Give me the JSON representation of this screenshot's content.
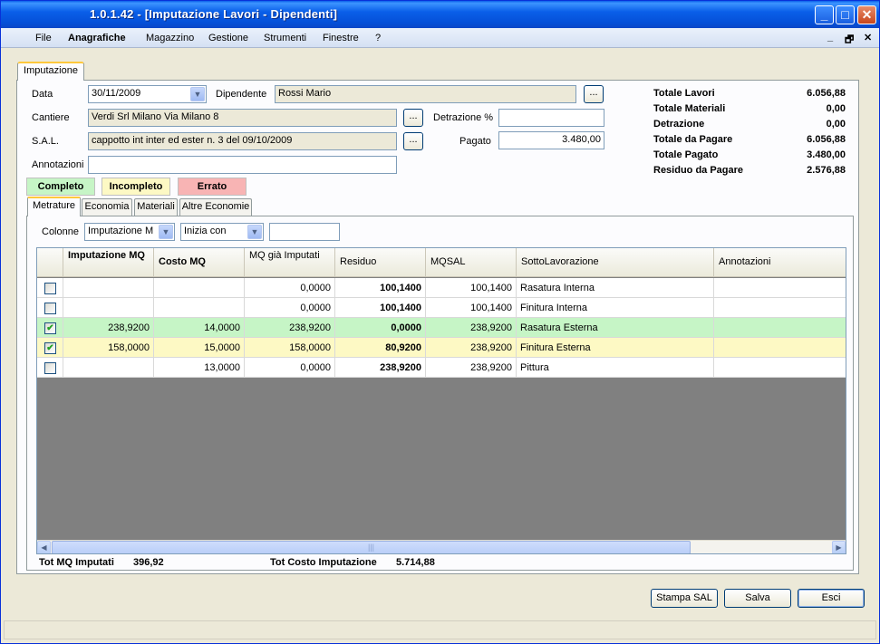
{
  "window": {
    "title": "1.0.1.42 - [Imputazione Lavori - Dipendenti]",
    "controls": {
      "minimize": "_",
      "maximize": "□",
      "close": "✕"
    }
  },
  "menu": {
    "items": [
      "File",
      "Anagrafiche",
      "Magazzino",
      "Gestione",
      "Strumenti",
      "Finestre",
      "?"
    ],
    "mdi_controls": [
      "_",
      "🗗",
      "✕"
    ]
  },
  "main_tab": "Imputazione",
  "form": {
    "data_label": "Data",
    "data_value": "30/11/2009",
    "dipendente_label": "Dipendente",
    "dipendente_value": "Rossi Mario",
    "cantiere_label": "Cantiere",
    "cantiere_value": "Verdi Srl Milano Via Milano 8",
    "sal_label": "S.A.L.",
    "sal_value": "cappotto int inter ed ester n. 3 del 09/10/2009",
    "annotazioni_label": "Annotazioni",
    "annotazioni_value": "",
    "detrazione_label": "Detrazione %",
    "detrazione_value": "",
    "pagato_label": "Pagato",
    "pagato_value": "3.480,00",
    "ellipsis": "..."
  },
  "totals": [
    {
      "label": "Totale Lavori",
      "value": "6.056,88"
    },
    {
      "label": "Totale Materiali",
      "value": "0,00"
    },
    {
      "label": "Detrazione",
      "value": "0,00"
    },
    {
      "label": "Totale da Pagare",
      "value": "6.056,88"
    },
    {
      "label": "Totale Pagato",
      "value": "3.480,00"
    },
    {
      "label": "Residuo da Pagare",
      "value": "2.576,88"
    }
  ],
  "status_legend": {
    "completo": "Completo",
    "incompleto": "Incompleto",
    "errato": "Errato",
    "colors": {
      "completo": "#c6f5c6",
      "incompleto": "#fdf9c4",
      "errato": "#f8b4b4"
    }
  },
  "subtabs": [
    "Metrature",
    "Economia",
    "Materiali",
    "Altre Economie"
  ],
  "filter": {
    "colonne_label": "Colonne",
    "colonne_value": "Imputazione M",
    "mode_value": "Inizia con",
    "search_value": ""
  },
  "grid": {
    "headers": [
      "",
      "Imputazione MQ",
      "Costo MQ",
      "MQ già Imputati",
      "Residuo",
      "MQSAL",
      "SottoLavorazione",
      "Annotazioni"
    ],
    "rows": [
      {
        "checked": false,
        "imputazione": "",
        "costo": "",
        "gia_imputati": "0,0000",
        "residuo": "100,1400",
        "mqsal": "100,1400",
        "sotto": "Rasatura Interna",
        "annot": "",
        "color": "#ffffff"
      },
      {
        "checked": false,
        "imputazione": "",
        "costo": "",
        "gia_imputati": "0,0000",
        "residuo": "100,1400",
        "mqsal": "100,1400",
        "sotto": "Finitura Interna",
        "annot": "",
        "color": "#ffffff"
      },
      {
        "checked": true,
        "imputazione": "238,9200",
        "costo": "14,0000",
        "gia_imputati": "238,9200",
        "residuo": "0,0000",
        "mqsal": "238,9200",
        "sotto": "Rasatura Esterna",
        "annot": "",
        "color": "#c6f5c6"
      },
      {
        "checked": true,
        "imputazione": "158,0000",
        "costo": "15,0000",
        "gia_imputati": "158,0000",
        "residuo": "80,9200",
        "mqsal": "238,9200",
        "sotto": "Finitura Esterna",
        "annot": "",
        "color": "#fdf9c4"
      },
      {
        "checked": false,
        "imputazione": "",
        "costo": "13,0000",
        "gia_imputati": "0,0000",
        "residuo": "238,9200",
        "mqsal": "238,9200",
        "sotto": "Pittura",
        "annot": "",
        "color": "#ffffff"
      }
    ]
  },
  "footer": {
    "tot_mq_label": "Tot MQ Imputati",
    "tot_mq_value": "396,92",
    "tot_costo_label": "Tot Costo Imputazione",
    "tot_costo_value": "5.714,88"
  },
  "buttons": {
    "stampa": "Stampa SAL",
    "salva": "Salva",
    "esci": "Esci"
  }
}
